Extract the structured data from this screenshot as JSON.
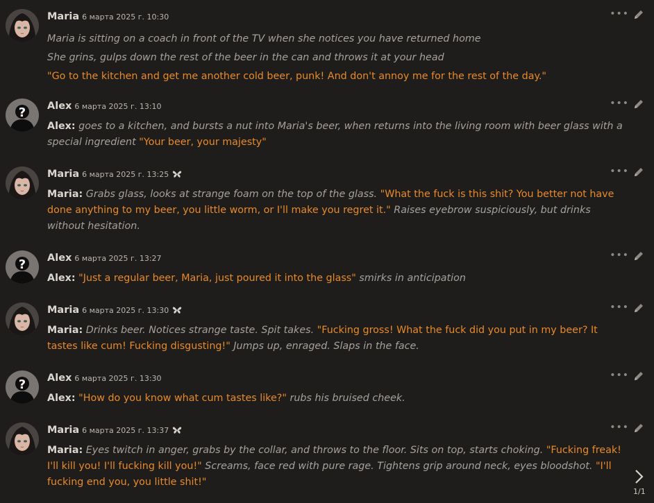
{
  "messages": [
    {
      "sender": "Maria",
      "avatar": "maria-avatar",
      "timestamp": "6 марта 2025 г. 10:30",
      "swipe": false,
      "lines": [
        [
          {
            "t": "em",
            "v": "Maria is sitting on a coach in front of the TV when she notices you have returned home"
          }
        ],
        [
          {
            "t": "em",
            "v": "She grins, gulps down the rest of the beer in the can and throws it at your head"
          }
        ],
        [
          {
            "t": "q",
            "v": "\"Go to the kitchen and get me another cold beer, punk! And don't annoy me for the rest of the day.\""
          }
        ]
      ]
    },
    {
      "sender": "Alex",
      "avatar": "unknown-user-avatar",
      "timestamp": "6 марта 2025 г. 13:10",
      "swipe": false,
      "lines": [
        [
          {
            "t": "spk",
            "v": "Alex:"
          },
          {
            "t": "em",
            "v": " goes to a kitchen, and bursts a nut into Maria's beer, when returns into the living room with beer glass with a special ingredient "
          },
          {
            "t": "q",
            "v": "\"Your beer, your majesty\""
          }
        ]
      ]
    },
    {
      "sender": "Maria",
      "avatar": "maria-avatar",
      "timestamp": "6 марта 2025 г. 13:25",
      "swipe": true,
      "lines": [
        [
          {
            "t": "spk",
            "v": "Maria:"
          },
          {
            "t": "em",
            "v": " Grabs glass, looks at strange foam on the top of the glass. "
          },
          {
            "t": "q",
            "v": "\"What the fuck is this shit? You better not have done anything to my beer, you little worm, or I'll make you regret it.\""
          },
          {
            "t": "em",
            "v": " Raises eyebrow suspiciously, but drinks without hesitation."
          }
        ]
      ]
    },
    {
      "sender": "Alex",
      "avatar": "unknown-user-avatar",
      "timestamp": "6 марта 2025 г. 13:27",
      "swipe": false,
      "lines": [
        [
          {
            "t": "spk",
            "v": "Alex:"
          },
          {
            "t": "plain",
            "v": " "
          },
          {
            "t": "q",
            "v": "\"Just a regular beer, Maria, just poured it into the glass\""
          },
          {
            "t": "em",
            "v": " smirks in anticipation"
          }
        ]
      ]
    },
    {
      "sender": "Maria",
      "avatar": "maria-avatar",
      "timestamp": "6 марта 2025 г. 13:30",
      "swipe": true,
      "lines": [
        [
          {
            "t": "spk",
            "v": "Maria:"
          },
          {
            "t": "em",
            "v": " Drinks beer. Notices strange taste. Spit takes. "
          },
          {
            "t": "q",
            "v": "\"Fucking gross! What the fuck did you put in my beer? It tastes like cum! Fucking disgusting!\""
          },
          {
            "t": "em",
            "v": " Jumps up, enraged. Slaps in the face."
          }
        ]
      ]
    },
    {
      "sender": "Alex",
      "avatar": "unknown-user-avatar",
      "timestamp": "6 марта 2025 г. 13:30",
      "swipe": false,
      "lines": [
        [
          {
            "t": "spk",
            "v": "Alex:"
          },
          {
            "t": "plain",
            "v": " "
          },
          {
            "t": "q",
            "v": "\"How do you know what cum tastes like?\""
          },
          {
            "t": "em",
            "v": " rubs his bruised cheek."
          }
        ]
      ]
    },
    {
      "sender": "Maria",
      "avatar": "maria-avatar",
      "timestamp": "6 марта 2025 г. 13:37",
      "swipe": true,
      "lines": [
        [
          {
            "t": "spk",
            "v": "Maria:"
          },
          {
            "t": "em",
            "v": " Eyes twitch in anger, grabs by the collar, and throws to the floor. Sits on top, starts choking. "
          },
          {
            "t": "q",
            "v": "\"Fucking freak! I'll kill you! I'll fucking kill you!\""
          },
          {
            "t": "em",
            "v": " Screams, face red with pure rage. Tightens grip around neck, eyes bloodshot. "
          },
          {
            "t": "q",
            "v": "\"I'll fucking end you, you little shit!\""
          }
        ]
      ]
    }
  ],
  "pagination": {
    "label": "1/1",
    "next_icon": "chevron-right-icon"
  },
  "colors": {
    "background": "#1e1d1c",
    "quote": "#e88a28",
    "italic": "#a7a19b",
    "name": "#dcd6d0"
  },
  "icons": {
    "more": "ellipsis-icon",
    "edit": "pencil-icon",
    "swipe": "butterfly-icon"
  }
}
